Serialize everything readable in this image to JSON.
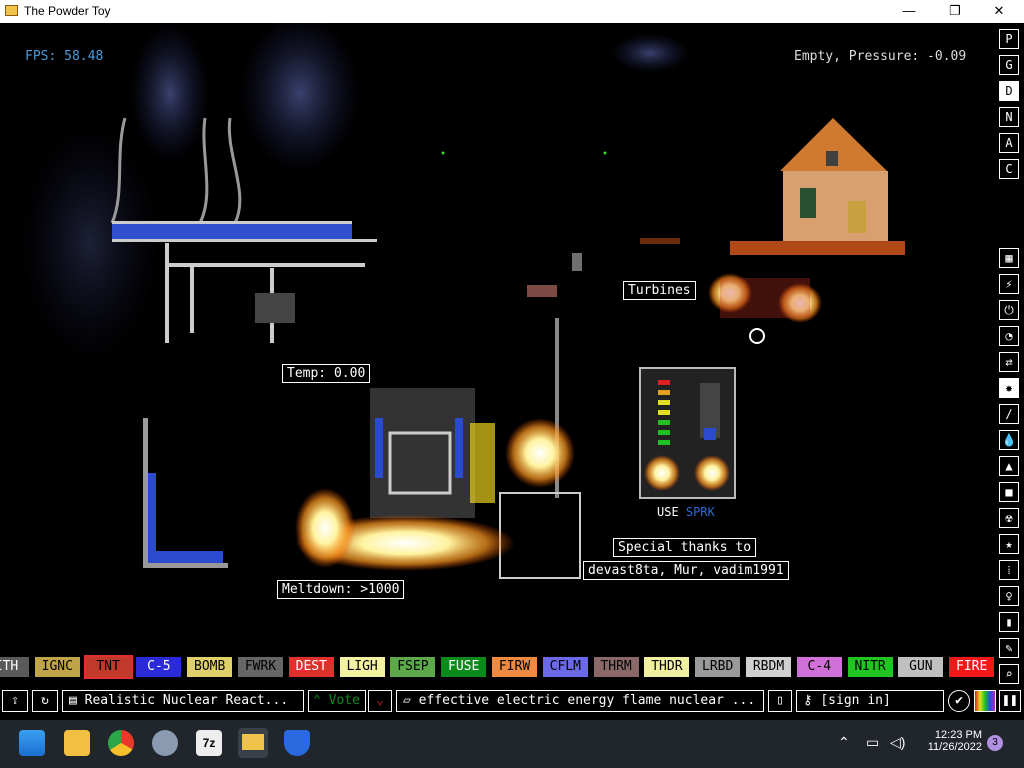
{
  "window": {
    "title": "The Powder Toy",
    "controls": {
      "minimize": "—",
      "maximize": "❐",
      "close": "✕"
    }
  },
  "hud": {
    "fps": "FPS: 58.48",
    "status": "Empty, Pressure: -0.09"
  },
  "signs": {
    "turbines": "Turbines",
    "temp": "Temp: 0.00",
    "meltdown": "Meltdown: >1000",
    "thanks1": "Special thanks to",
    "thanks2": "devast8ta, Mur, vadim1991",
    "use": "USE",
    "sprk": "SPRK"
  },
  "render_modes": [
    "P",
    "G",
    "D",
    "N",
    "A",
    "C"
  ],
  "elements": [
    {
      "label": "ITH",
      "bg": "#5a5a5a",
      "fg": "#ffffff"
    },
    {
      "label": "IGNC",
      "bg": "#c0a44a",
      "fg": "#000000"
    },
    {
      "label": "TNT",
      "bg": "#c0392b",
      "fg": "#000000"
    },
    {
      "label": "C-5",
      "bg": "#2a2ad8",
      "fg": "#ffffff"
    },
    {
      "label": "BOMB",
      "bg": "#e0d06a",
      "fg": "#000000"
    },
    {
      "label": "FWRK",
      "bg": "#666666",
      "fg": "#000000"
    },
    {
      "label": "DEST",
      "bg": "#e0302c",
      "fg": "#ffffff"
    },
    {
      "label": "LIGH",
      "bg": "#f2f2a0",
      "fg": "#000000"
    },
    {
      "label": "FSEP",
      "bg": "#5ca84a",
      "fg": "#000000"
    },
    {
      "label": "FUSE",
      "bg": "#0a8a1a",
      "fg": "#ffffff"
    },
    {
      "label": "FIRW",
      "bg": "#f08a40",
      "fg": "#000000"
    },
    {
      "label": "CFLM",
      "bg": "#6a6ae8",
      "fg": "#000000"
    },
    {
      "label": "THRM",
      "bg": "#8a6868",
      "fg": "#000000"
    },
    {
      "label": "THDR",
      "bg": "#f0f0a0",
      "fg": "#000000"
    },
    {
      "label": "LRBD",
      "bg": "#9a9a9a",
      "fg": "#000000"
    },
    {
      "label": "RBDM",
      "bg": "#d0d0d0",
      "fg": "#000000"
    },
    {
      "label": "C-4",
      "bg": "#d070d8",
      "fg": "#000000"
    },
    {
      "label": "NITR",
      "bg": "#22c422",
      "fg": "#000000"
    },
    {
      "label": "GUN",
      "bg": "#c0c0c0",
      "fg": "#000000"
    },
    {
      "label": "FIRE",
      "bg": "#f01818",
      "fg": "#ffffff"
    }
  ],
  "bottom": {
    "save_title": "Realistic Nuclear React...",
    "vote_label": "Vote",
    "tags": "effective electric energy flame nuclear ...",
    "signin": "[sign in]"
  },
  "taskbar": {
    "time": "12:23 PM",
    "date": "11/26/2022",
    "notification_count": "3",
    "apps": [
      "start",
      "file-explorer",
      "chrome",
      "settings",
      "7zip",
      "powder-toy",
      "defender"
    ]
  }
}
